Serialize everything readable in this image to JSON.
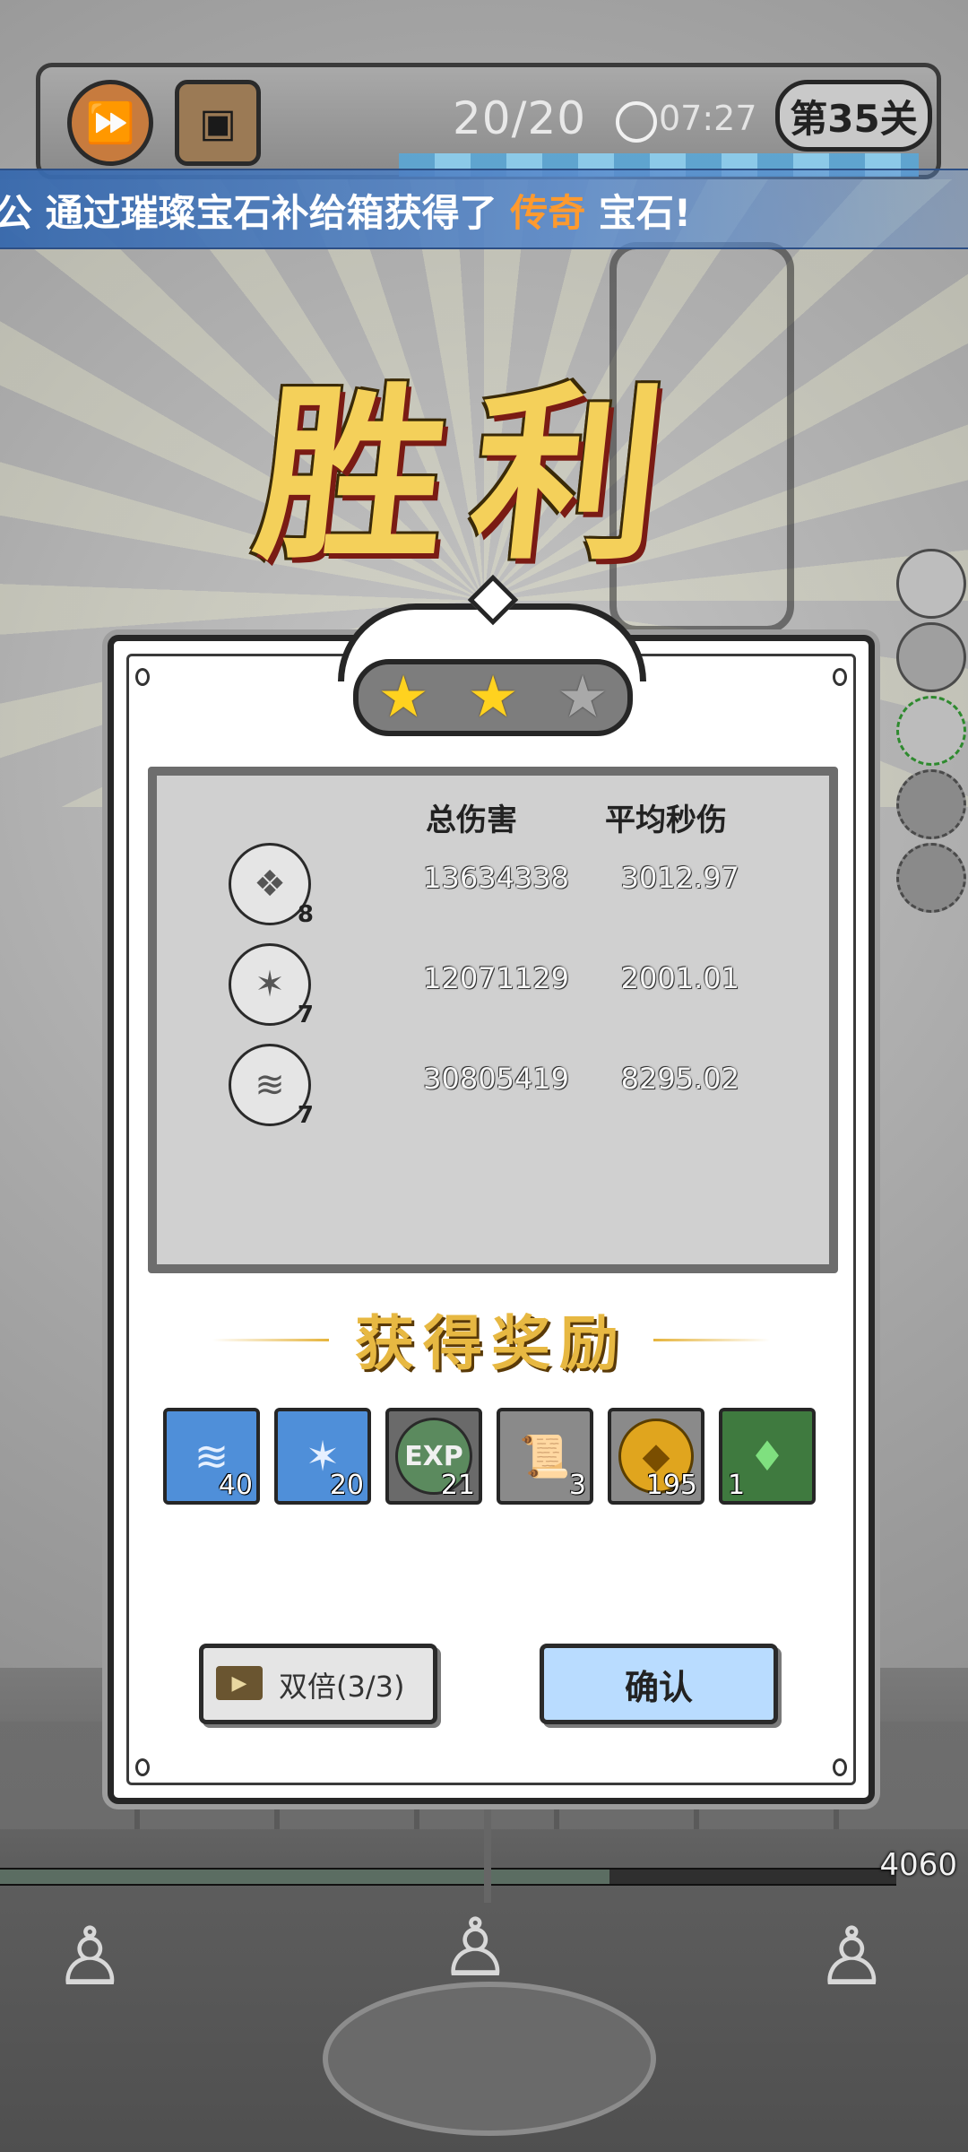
{
  "hud": {
    "wave_count": "20/20",
    "timer": "07:27",
    "level_label": "第35关"
  },
  "banner": {
    "prefix": "公 通过璀璨宝石补给箱获得了 ",
    "highlight": "传奇",
    "suffix": " 宝石!"
  },
  "victory_title": "胜利",
  "stars": {
    "earned": 2,
    "total": 3
  },
  "stats": {
    "col_total": "总伤害",
    "col_avg": "平均秒伤",
    "rows": [
      {
        "icon": "crystal-shard-icon",
        "level": "8",
        "total": "13634338",
        "avg": "3012.97"
      },
      {
        "icon": "crystal-burst-icon",
        "level": "7",
        "total": "12071129",
        "avg": "2001.01"
      },
      {
        "icon": "tornado-icon",
        "level": "7",
        "total": "30805419",
        "avg": "8295.02"
      }
    ]
  },
  "rewards": {
    "title": "获得奖励",
    "items": [
      {
        "name": "tornado-card-icon",
        "count": "40",
        "bg": "#4f8fd9"
      },
      {
        "name": "crystal-card-icon",
        "count": "20",
        "bg": "#4f8fd9"
      },
      {
        "name": "exp-badge-icon",
        "label": "EXP",
        "count": "21",
        "bg": "#5b8a5e"
      },
      {
        "name": "scroll-icon",
        "count": "3",
        "bg": "#6e6e6e"
      },
      {
        "name": "gold-coin-icon",
        "count": "195",
        "bg": "#6e6e6e"
      },
      {
        "name": "green-gem-icon",
        "count": "1",
        "bg": "#3f7a3f"
      }
    ]
  },
  "buttons": {
    "double_label": "双倍(3/3)",
    "confirm_label": "确认"
  },
  "enemy_hp": {
    "value": "4060",
    "fraction": 0.68
  },
  "colors": {
    "banner_highlight": "#ff9a2e",
    "confirm_bg": "#b9dcff",
    "star_on": "#ffd21f",
    "victory_gold": "#f4d05a"
  }
}
